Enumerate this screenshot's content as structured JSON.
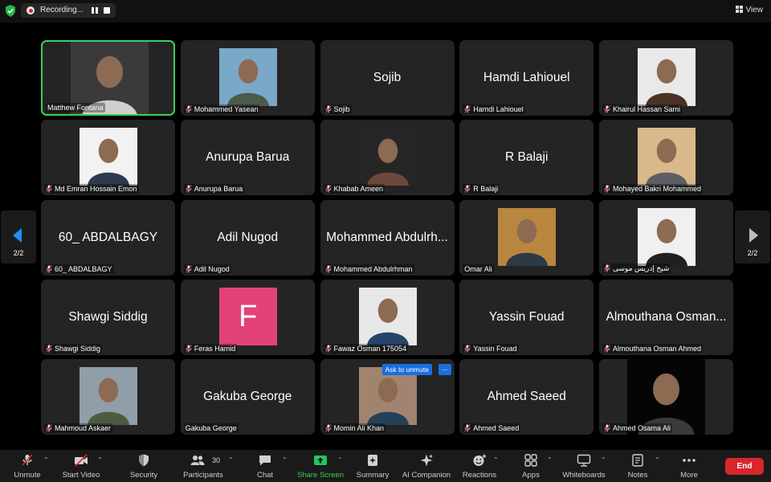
{
  "topbar": {
    "recording_label": "Recording...",
    "view_label": "View"
  },
  "pager": {
    "left": "2/2",
    "right": "2/2"
  },
  "tiles": [
    {
      "name": "Matthew Fontana",
      "big": "",
      "muted": false,
      "active": true,
      "kind": "photo-wide",
      "photo_colors": [
        "#3a3a3a",
        "#cfcfcf"
      ]
    },
    {
      "name": "Mohammed Yasean",
      "big": "",
      "muted": true,
      "kind": "photo",
      "photo_colors": [
        "#7aa8c8",
        "#4b5b4a"
      ]
    },
    {
      "name": "Sojib",
      "big": "Sojib",
      "muted": true,
      "kind": "text"
    },
    {
      "name": "Hamdi Lahiouel",
      "big": "Hamdi Lahiouel",
      "muted": true,
      "kind": "text"
    },
    {
      "name": "Khairul Hassan Sami",
      "big": "",
      "muted": true,
      "kind": "photo",
      "photo_colors": [
        "#e9e9e9",
        "#4a3326"
      ]
    },
    {
      "name": "Md Emran Hossain Emon",
      "big": "",
      "muted": true,
      "kind": "photo",
      "photo_colors": [
        "#f2f2f2",
        "#2f3a4e"
      ]
    },
    {
      "name": "Anurupa Barua",
      "big": "Anurupa Barua",
      "muted": true,
      "kind": "text"
    },
    {
      "name": "Khabab Ameen",
      "big": "",
      "muted": true,
      "kind": "photo",
      "photo_colors": [
        "#262626",
        "#6b4a3a"
      ]
    },
    {
      "name": "R Balaji",
      "big": "R Balaji",
      "muted": true,
      "kind": "text"
    },
    {
      "name": "Mohayed Bakri Mohammed",
      "big": "",
      "muted": true,
      "kind": "photo",
      "photo_colors": [
        "#d9b98a",
        "#5c5f63"
      ]
    },
    {
      "name": "60_ ABDALBAGY",
      "big": "60_ ABDALBAGY",
      "muted": true,
      "kind": "text"
    },
    {
      "name": "Adil Nugod",
      "big": "Adil Nugod",
      "muted": true,
      "kind": "text"
    },
    {
      "name": "Mohammed Abdulrhman",
      "big": "Mohammed Abdulrh...",
      "muted": true,
      "kind": "text"
    },
    {
      "name": "Omar Ali",
      "big": "",
      "muted": false,
      "kind": "photo",
      "photo_colors": [
        "#b9863f",
        "#2c3a44"
      ]
    },
    {
      "name": "شيخ إدريس موسى",
      "big": "",
      "muted": true,
      "kind": "photo",
      "photo_colors": [
        "#f0f0f0",
        "#202020"
      ]
    },
    {
      "name": "Shawgi Siddig",
      "big": "Shawgi Siddig",
      "muted": true,
      "kind": "text"
    },
    {
      "name": "Feras Hamid",
      "big": "",
      "muted": true,
      "kind": "letter",
      "letter": "F"
    },
    {
      "name": "Fawaz Osman 175054",
      "big": "",
      "muted": true,
      "kind": "photo",
      "photo_colors": [
        "#e8e8e8",
        "#27456a"
      ]
    },
    {
      "name": "Yassin Fouad",
      "big": "Yassin Fouad",
      "muted": true,
      "kind": "text"
    },
    {
      "name": "Almouthana Osman Ahmed",
      "big": "Almouthana Osman...",
      "muted": true,
      "kind": "text"
    },
    {
      "name": "Mahmoud Askaer",
      "big": "",
      "muted": true,
      "kind": "photo",
      "photo_colors": [
        "#8f9ea8",
        "#4d5b40"
      ]
    },
    {
      "name": "Gakuba George",
      "big": "Gakuba George",
      "muted": false,
      "kind": "text"
    },
    {
      "name": "Momin Ali Khan",
      "big": "",
      "muted": true,
      "kind": "photo",
      "photo_colors": [
        "#a08470",
        "#24415a"
      ],
      "ask": "Ask to unmute",
      "more": "..."
    },
    {
      "name": "Ahmed Saeed",
      "big": "Ahmed Saeed",
      "muted": true,
      "kind": "text"
    },
    {
      "name": "Ahmed Osama Ali",
      "big": "",
      "muted": true,
      "kind": "photo-wide",
      "photo_colors": [
        "#050505",
        "#3a3a3a"
      ]
    }
  ],
  "toolbar": {
    "unmute": "Unmute",
    "start_video": "Start Video",
    "security": "Security",
    "participants": "Participants",
    "participants_count": "30",
    "chat": "Chat",
    "share_screen": "Share Screen",
    "summary": "Summary",
    "ai_companion": "AI Companion",
    "reactions": "Reactions",
    "apps": "Apps",
    "whiteboards": "Whiteboards",
    "notes": "Notes",
    "more": "More",
    "end": "End"
  },
  "colors": {
    "active_border": "#3bd15a",
    "share_green": "#22c55e",
    "end_red": "#d8262c",
    "popup_blue": "#1a6fe0",
    "muted_red": "#e02828"
  }
}
